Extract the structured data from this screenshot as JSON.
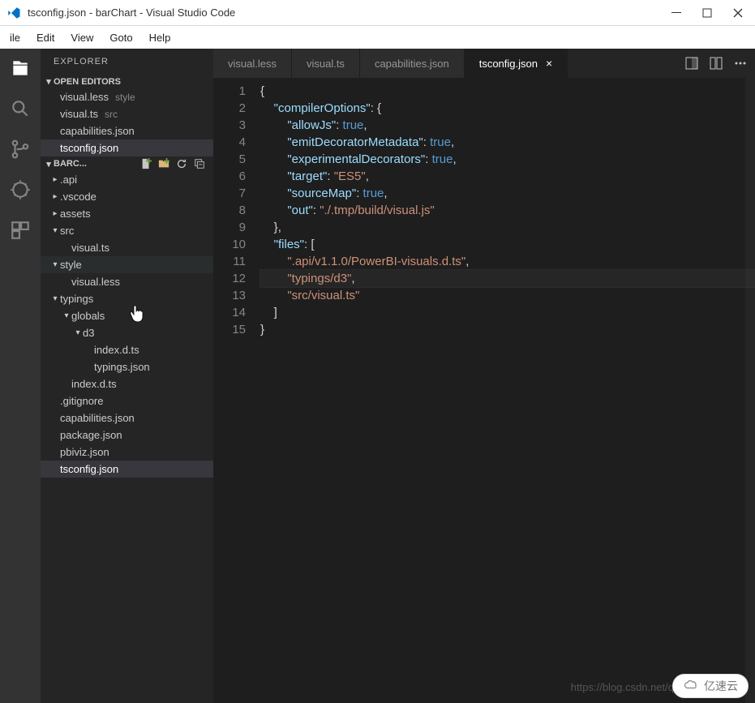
{
  "window": {
    "title": "tsconfig.json - barChart - Visual Studio Code"
  },
  "menu": {
    "file": "ile",
    "edit": "Edit",
    "view": "View",
    "goto": "Goto",
    "help": "Help"
  },
  "sidebar": {
    "title": "EXPLORER",
    "openEditorsLabel": "OPEN EDITORS",
    "openEditors": [
      {
        "name": "visual.less",
        "dir": "style"
      },
      {
        "name": "visual.ts",
        "dir": "src"
      },
      {
        "name": "capabilities.json",
        "dir": ""
      },
      {
        "name": "tsconfig.json",
        "dir": ""
      }
    ],
    "projectLabel": "BARC...",
    "tree": [
      {
        "type": "folder",
        "label": ".api",
        "indent": 0,
        "expanded": false
      },
      {
        "type": "folder",
        "label": ".vscode",
        "indent": 0,
        "expanded": false
      },
      {
        "type": "folder",
        "label": "assets",
        "indent": 0,
        "expanded": false
      },
      {
        "type": "folder",
        "label": "src",
        "indent": 0,
        "expanded": true
      },
      {
        "type": "file",
        "label": "visual.ts",
        "indent": 1
      },
      {
        "type": "folder",
        "label": "style",
        "indent": 0,
        "expanded": true,
        "hover": true
      },
      {
        "type": "file",
        "label": "visual.less",
        "indent": 1
      },
      {
        "type": "folder",
        "label": "typings",
        "indent": 0,
        "expanded": true
      },
      {
        "type": "folder",
        "label": "globals",
        "indent": 1,
        "expanded": true
      },
      {
        "type": "folder",
        "label": "d3",
        "indent": 2,
        "expanded": true
      },
      {
        "type": "file",
        "label": "index.d.ts",
        "indent": 3
      },
      {
        "type": "file",
        "label": "typings.json",
        "indent": 3
      },
      {
        "type": "file",
        "label": "index.d.ts",
        "indent": 1
      },
      {
        "type": "file",
        "label": ".gitignore",
        "indent": 0
      },
      {
        "type": "file",
        "label": "capabilities.json",
        "indent": 0
      },
      {
        "type": "file",
        "label": "package.json",
        "indent": 0
      },
      {
        "type": "file",
        "label": "pbiviz.json",
        "indent": 0
      },
      {
        "type": "file",
        "label": "tsconfig.json",
        "indent": 0,
        "selected": true
      }
    ]
  },
  "tabs": [
    {
      "label": "visual.less",
      "active": false
    },
    {
      "label": "visual.ts",
      "active": false
    },
    {
      "label": "capabilities.json",
      "active": false
    },
    {
      "label": "tsconfig.json",
      "active": true
    }
  ],
  "editor": {
    "activeFile": "tsconfig.json",
    "currentLine": 12,
    "content": {
      "compilerOptions": {
        "allowJs": true,
        "emitDecoratorMetadata": true,
        "experimentalDecorators": true,
        "target": "ES5",
        "sourceMap": true,
        "out": "./.tmp/build/visual.js"
      },
      "files": [
        ".api/v1.1.0/PowerBI-visuals.d.ts",
        "typings/d3",
        "src/visual.ts"
      ]
    },
    "lines": [
      {
        "n": 1,
        "t": [
          [
            "brace",
            "{"
          ]
        ]
      },
      {
        "n": 2,
        "t": [
          [
            "pad",
            "    "
          ],
          [
            "key",
            "\"compilerOptions\""
          ],
          [
            "punc",
            ": "
          ],
          [
            "brace",
            "{"
          ]
        ]
      },
      {
        "n": 3,
        "t": [
          [
            "pad",
            "        "
          ],
          [
            "key",
            "\"allowJs\""
          ],
          [
            "punc",
            ": "
          ],
          [
            "bool",
            "true"
          ],
          [
            "punc",
            ","
          ]
        ]
      },
      {
        "n": 4,
        "t": [
          [
            "pad",
            "        "
          ],
          [
            "key",
            "\"emitDecoratorMetadata\""
          ],
          [
            "punc",
            ": "
          ],
          [
            "bool",
            "true"
          ],
          [
            "punc",
            ","
          ]
        ]
      },
      {
        "n": 5,
        "t": [
          [
            "pad",
            "        "
          ],
          [
            "key",
            "\"experimentalDecorators\""
          ],
          [
            "punc",
            ": "
          ],
          [
            "bool",
            "true"
          ],
          [
            "punc",
            ","
          ]
        ]
      },
      {
        "n": 6,
        "t": [
          [
            "pad",
            "        "
          ],
          [
            "key",
            "\"target\""
          ],
          [
            "punc",
            ": "
          ],
          [
            "str",
            "\"ES5\""
          ],
          [
            "punc",
            ","
          ]
        ]
      },
      {
        "n": 7,
        "t": [
          [
            "pad",
            "        "
          ],
          [
            "key",
            "\"sourceMap\""
          ],
          [
            "punc",
            ": "
          ],
          [
            "bool",
            "true"
          ],
          [
            "punc",
            ","
          ]
        ]
      },
      {
        "n": 8,
        "t": [
          [
            "pad",
            "        "
          ],
          [
            "key",
            "\"out\""
          ],
          [
            "punc",
            ": "
          ],
          [
            "str",
            "\"./.tmp/build/visual.js\""
          ]
        ]
      },
      {
        "n": 9,
        "t": [
          [
            "pad",
            "    "
          ],
          [
            "brace",
            "}"
          ],
          [
            "punc",
            ","
          ]
        ]
      },
      {
        "n": 10,
        "t": [
          [
            "pad",
            "    "
          ],
          [
            "key",
            "\"files\""
          ],
          [
            "punc",
            ": "
          ],
          [
            "brace",
            "["
          ]
        ]
      },
      {
        "n": 11,
        "t": [
          [
            "pad",
            "        "
          ],
          [
            "str",
            "\".api/v1.1.0/PowerBI-visuals.d.ts\""
          ],
          [
            "punc",
            ","
          ]
        ]
      },
      {
        "n": 12,
        "t": [
          [
            "pad",
            "        "
          ],
          [
            "str",
            "\"typings/d3\""
          ],
          [
            "punc",
            ","
          ]
        ]
      },
      {
        "n": 13,
        "t": [
          [
            "pad",
            "        "
          ],
          [
            "str",
            "\"src/visual.ts\""
          ]
        ]
      },
      {
        "n": 14,
        "t": [
          [
            "pad",
            "    "
          ],
          [
            "brace",
            "]"
          ]
        ]
      },
      {
        "n": 15,
        "t": [
          [
            "brace",
            "}"
          ]
        ]
      }
    ]
  },
  "footer": {
    "url": "https://blog.csdn.net/q",
    "watermark": "亿速云"
  }
}
